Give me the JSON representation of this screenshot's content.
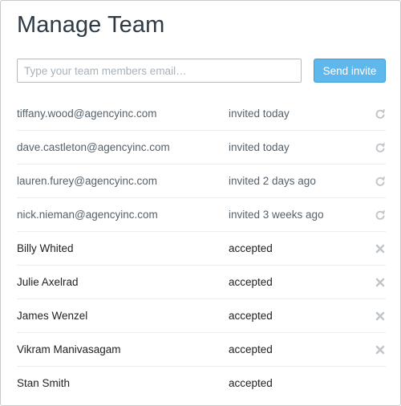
{
  "header": {
    "title": "Manage Team"
  },
  "invite": {
    "email_placeholder": "Type your team members email…",
    "email_value": "",
    "send_label": "Send invite"
  },
  "colors": {
    "accent": "#5fb8ec",
    "icon_gray": "#c2c6ca"
  },
  "members": [
    {
      "name": "tiffany.wood@agencyinc.com",
      "status": "invited today",
      "state": "invited",
      "action_icon": "refresh-icon"
    },
    {
      "name": "dave.castleton@agencyinc.com",
      "status": "invited today",
      "state": "invited",
      "action_icon": "refresh-icon"
    },
    {
      "name": "lauren.furey@agencyinc.com",
      "status": "invited 2 days ago",
      "state": "invited",
      "action_icon": "refresh-icon"
    },
    {
      "name": "nick.nieman@agencyinc.com",
      "status": "invited 3 weeks ago",
      "state": "invited",
      "action_icon": "refresh-icon"
    },
    {
      "name": "Billy Whited",
      "status": "accepted",
      "state": "accepted",
      "action_icon": "remove-icon"
    },
    {
      "name": "Julie Axelrad",
      "status": "accepted",
      "state": "accepted",
      "action_icon": "remove-icon"
    },
    {
      "name": "James Wenzel",
      "status": "accepted",
      "state": "accepted",
      "action_icon": "remove-icon"
    },
    {
      "name": "Vikram Manivasagam",
      "status": "accepted",
      "state": "accepted",
      "action_icon": "remove-icon"
    },
    {
      "name": "Stan Smith",
      "status": "accepted",
      "state": "accepted",
      "action_icon": ""
    }
  ]
}
